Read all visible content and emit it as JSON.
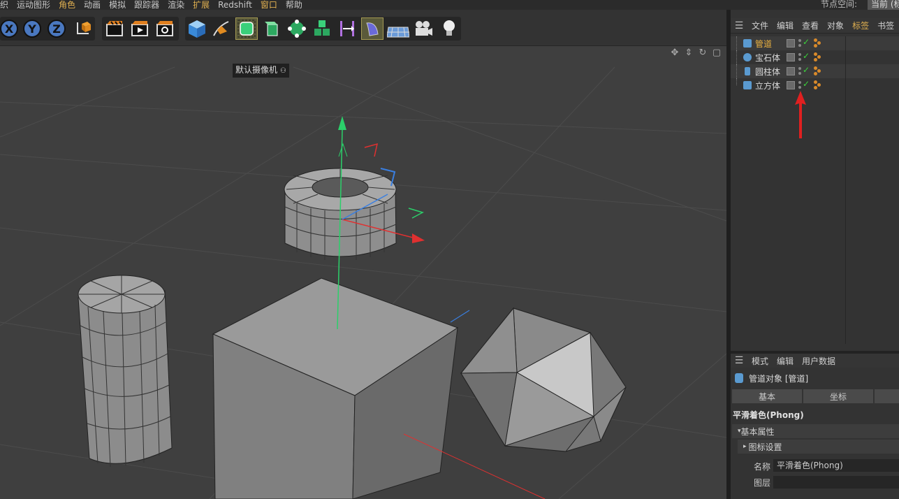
{
  "menubar": {
    "items": [
      "织",
      "运动图形",
      "角色",
      "动画",
      "模拟",
      "跟踪器",
      "渲染",
      "扩展",
      "Redshift",
      "窗口",
      "帮助"
    ],
    "highlighted": [
      "角色",
      "扩展",
      "窗口"
    ],
    "node_space_label": "节点空间:",
    "node_space_value": "当前 (标"
  },
  "toolbar": {
    "axis_x": "X",
    "axis_y": "Y",
    "axis_z": "Z",
    "tools": [
      "coordinate-system-icon",
      "render-view-icon",
      "render-picture-viewer-icon",
      "render-settings-icon",
      "cube-icon",
      "pen-spline-icon",
      "subdivision-surface-icon",
      "extrude-icon",
      "cloner-icon",
      "mograph-cubes-icon",
      "symmetry-icon",
      "deformer-icon",
      "floor-plane-icon",
      "camera-icon",
      "light-icon"
    ]
  },
  "viewport": {
    "camera_label": "默认摄像机",
    "nav_icons": [
      "move-view-icon",
      "zoom-view-icon",
      "rotate-view-icon",
      "toggle-view-icon"
    ]
  },
  "object_manager": {
    "menu": [
      "文件",
      "编辑",
      "查看",
      "对象",
      "标签",
      "书签"
    ],
    "highlighted_menu": "标签",
    "objects": [
      {
        "name": "管道",
        "selected": true,
        "icon": "tube-icon"
      },
      {
        "name": "宝石体",
        "selected": false,
        "icon": "gem-icon"
      },
      {
        "name": "圆柱体",
        "selected": false,
        "icon": "cylinder-icon"
      },
      {
        "name": "立方体",
        "selected": false,
        "icon": "cube-icon"
      }
    ]
  },
  "attribute_manager": {
    "menu": [
      "模式",
      "编辑",
      "用户数据"
    ],
    "title": "管道对象 [管道]",
    "tabs": [
      "基本",
      "坐标",
      ""
    ],
    "section_title": "平滑着色(Phong)",
    "group_basic": "基本属性",
    "group_icon": "图标设置",
    "name_label": "名称",
    "name_value": "平滑着色(Phong)",
    "layer_label": "图层",
    "layer_value": ""
  },
  "colors": {
    "accent_orange": "#e8b040",
    "check_green": "#3bd13b",
    "arrow_red": "#e02020",
    "axis_green": "#2bd06a",
    "axis_blue": "#3a7fe0"
  }
}
